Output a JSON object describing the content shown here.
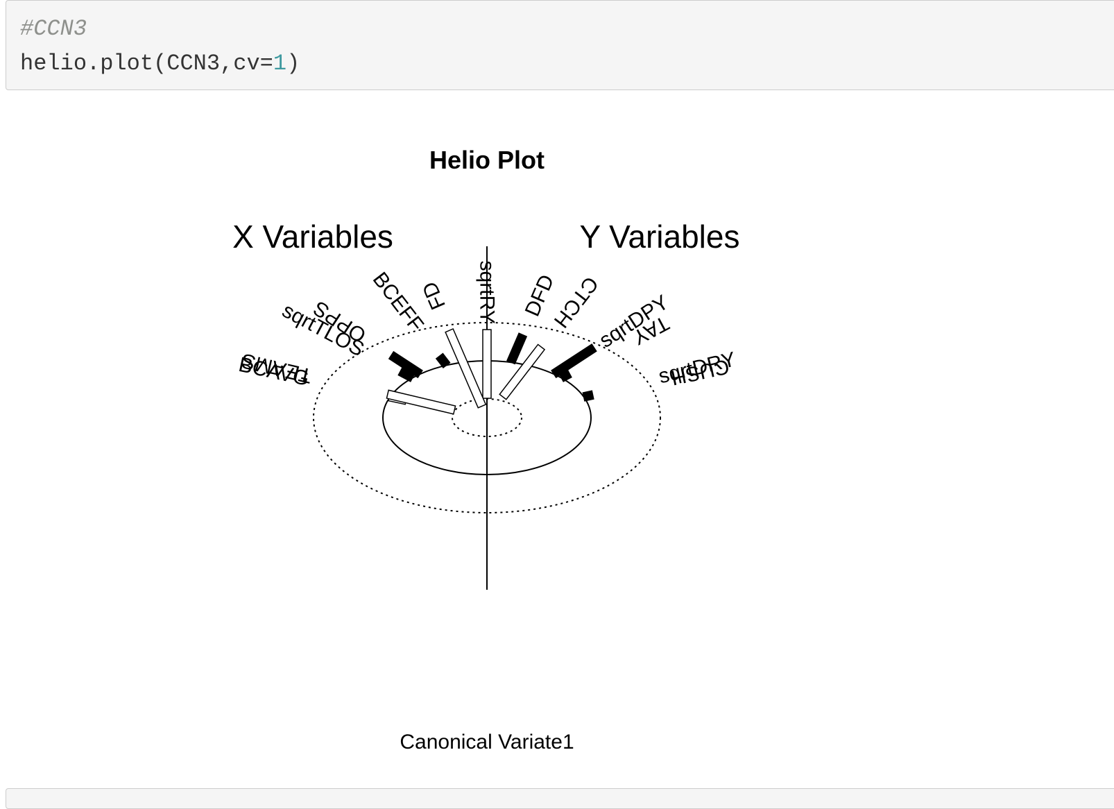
{
  "code": {
    "comment": "#CCN3",
    "call_prefix": "helio.plot(CCN3,cv=",
    "call_number": "1",
    "call_suffix": ")"
  },
  "chart_data": {
    "type": "helio",
    "title": "Helio Plot",
    "xlabel": "Canonical Variate1",
    "left_heading": "X Variables",
    "right_heading": "Y Variables",
    "x_variables": [
      {
        "name": "CUSH",
        "value": 0.08
      },
      {
        "name": "TAY",
        "value": 0.08
      },
      {
        "name": "CTCH",
        "value": -0.55
      },
      {
        "name": "sqrtRY",
        "value": -0.6
      },
      {
        "name": "BCEFF",
        "value": 0.1
      },
      {
        "name": "sqrtTLOS",
        "value": 0.12
      },
      {
        "name": "BCAVG",
        "value": -0.15
      }
    ],
    "y_variables": [
      {
        "name": "TEAMS",
        "value": -0.6
      },
      {
        "name": "OPPS",
        "value": 0.3
      },
      {
        "name": "FD",
        "value": -0.72
      },
      {
        "name": "DFD",
        "value": 0.26
      },
      {
        "name": "sqrtDPY",
        "value": 0.42
      },
      {
        "name": "sqrtDRY",
        "value": 0
      }
    ]
  }
}
